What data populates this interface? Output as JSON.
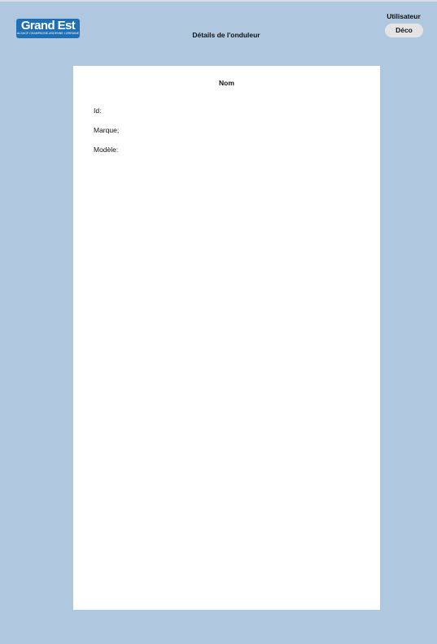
{
  "header": {
    "logo": {
      "name": "Grand Est",
      "tagline": "ALSACE CHAMPAGNE-ARDENNE LORRAINE"
    },
    "title": "Détails de l'onduleur",
    "user_label": "Utilisateur",
    "logout_label": "Déco"
  },
  "card": {
    "title": "Nom",
    "fields": [
      {
        "label": "Id:",
        "value": ""
      },
      {
        "label": "Marque;",
        "value": ""
      },
      {
        "label": "Modèle:",
        "value": ""
      }
    ]
  },
  "colors": {
    "page_background": "#b0c8df",
    "card_background": "#ffffff",
    "logo_background": "#1e6fb3",
    "button_background": "#e4e4e4"
  }
}
